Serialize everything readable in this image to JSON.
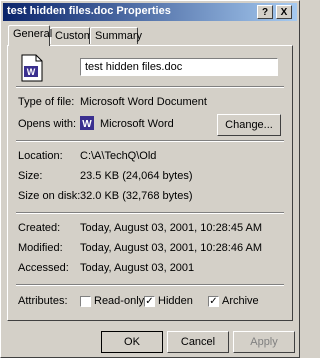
{
  "window": {
    "title": "test hidden files.doc Properties",
    "help_symbol": "?",
    "close_symbol": "X"
  },
  "tabs": [
    {
      "label": "General",
      "active": true
    },
    {
      "label": "Custom",
      "active": false
    },
    {
      "label": "Summary",
      "active": false
    }
  ],
  "general": {
    "filename": "test hidden files.doc",
    "type_of_file_label": "Type of file:",
    "type_of_file_value": "Microsoft Word Document",
    "opens_with_label": "Opens with:",
    "opens_with_value": "Microsoft Word",
    "change_button": "Change...",
    "location_label": "Location:",
    "location_value": "C:\\A\\TechQ\\Old",
    "size_label": "Size:",
    "size_value": "23.5 KB (24,064 bytes)",
    "size_on_disk_label": "Size on disk:",
    "size_on_disk_value": "32.0 KB (32,768 bytes)",
    "created_label": "Created:",
    "created_value": "Today, August 03, 2001, 10:28:45 AM",
    "modified_label": "Modified:",
    "modified_value": "Today, August 03, 2001, 10:28:46 AM",
    "accessed_label": "Accessed:",
    "accessed_value": "Today, August 03, 2001",
    "attributes_label": "Attributes:",
    "attributes": [
      {
        "label": "Read-only",
        "checked": false
      },
      {
        "label": "Hidden",
        "checked": true
      },
      {
        "label": "Archive",
        "checked": true
      }
    ]
  },
  "buttons": {
    "ok": "OK",
    "cancel": "Cancel",
    "apply": "Apply"
  },
  "colors": {
    "titlebar_start": "#0a246a",
    "titlebar_end": "#a6caf0",
    "word_icon": "#3a2f8f"
  },
  "icons": {
    "file_icon": "word-document-icon",
    "opens_with_icon": "word-app-icon"
  }
}
